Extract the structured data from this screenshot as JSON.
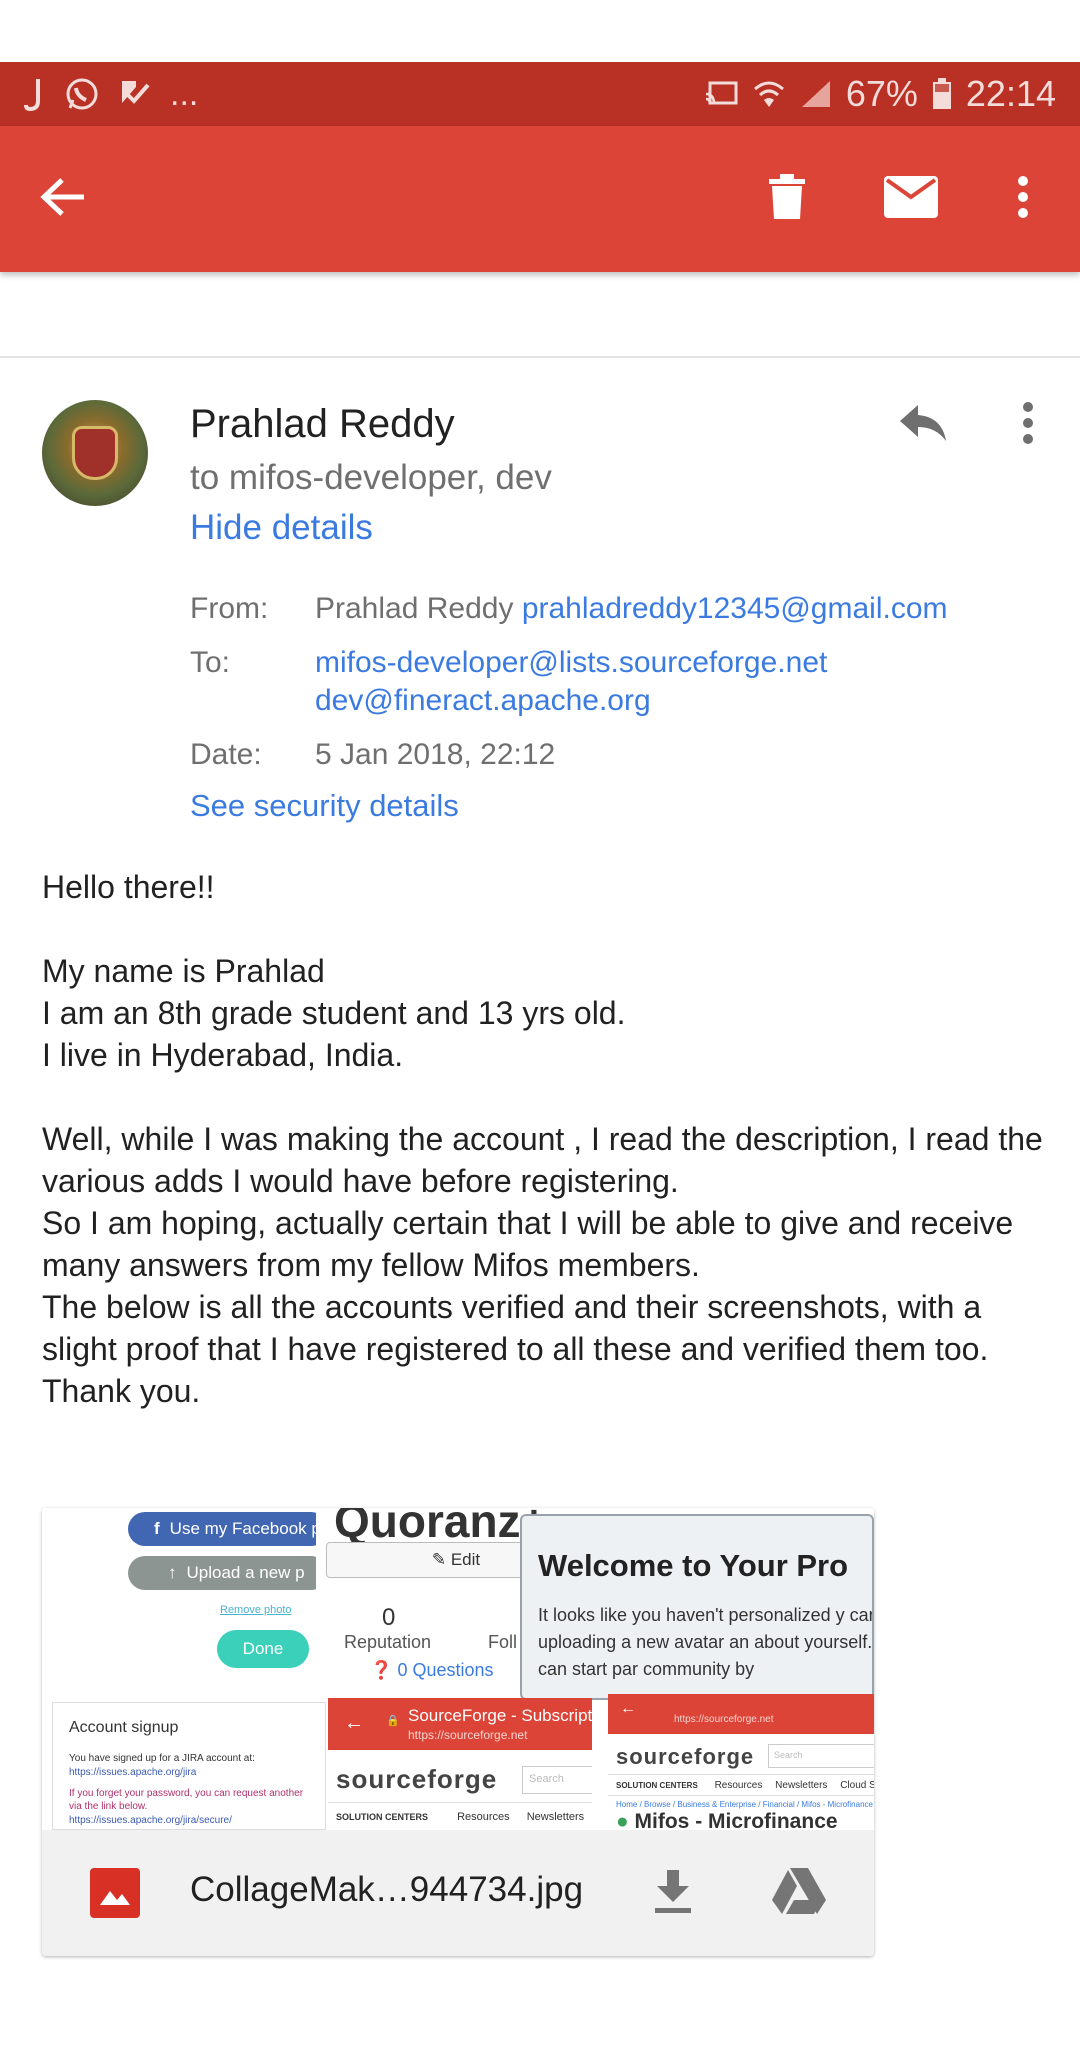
{
  "status_bar": {
    "time": "22:14",
    "battery": "67%",
    "overflow": "...",
    "colors": {
      "bg": "#b93025"
    }
  },
  "app_bar": {
    "back_icon": "arrow-back-icon",
    "actions": [
      "delete-icon",
      "mail-icon",
      "more-vert-icon"
    ],
    "colors": {
      "bg": "#db4437"
    }
  },
  "message": {
    "sender": "Prahlad Reddy",
    "recipients": "to mifos-developer, dev",
    "hide_details": "Hide details",
    "details": {
      "from_label": "From:",
      "from_name": "Prahlad Reddy",
      "from_email": "prahladreddy12345@gmail.com",
      "to_label": "To:",
      "to_1": "mifos-developer@lists.sourceforge.net",
      "to_2": "dev@fineract.apache.org",
      "date_label": "Date:",
      "date": "5 Jan 2018, 22:12"
    },
    "security_link": "See security details",
    "body": {
      "greeting": "Hello there!!",
      "para1": "My name is Prahlad\nI am an 8th grade student and 13 yrs old.\nI live in Hyderabad, India.",
      "para2": "Well, while I was making the account , I read the description, I read the various adds I would have before registering.\nSo I am hoping, actually certain that I will be able to give and receive many answers from my fellow Mifos members.\nThe below is all the accounts verified and their screenshots, with a slight proof that I have registered to all these and verified them too.\nThank you."
    }
  },
  "attachment": {
    "file_name": "CollageMak…944734.jpg",
    "preview": {
      "fb_button": "Use my Facebook p",
      "upload_button": "Upload a new p",
      "remove_photo": "Remove photo",
      "done_button": "Done",
      "qa_title": "Quoranz+",
      "edit_button": "Edit",
      "reputation_value": "0",
      "reputation_label": "Reputation",
      "following_label": "Foll",
      "questions": "0 Questions",
      "welcome_title": "Welcome to Your Pro",
      "welcome_text": "It looks like you haven't personalized y can start by uploading a new avatar an about yourself. Then you can start par community by",
      "jira_title": "Account signup",
      "jira_line1": "You have signed up for a JIRA account at:",
      "jira_link1": "https://issues.apache.org/jira",
      "jira_line2": "If you forget your password, you can request another via the link below.",
      "jira_link2": "https://issues.apache.org/jira/secure/",
      "sf_tab_title": "SourceForge - Subscript",
      "sf_url": "https://sourceforge.net",
      "sf_logo": "sourceforge",
      "sf_search": "Search",
      "sf_nav": [
        "SOLUTION CENTERS",
        "Resources",
        "Newsletters",
        "Cloud St"
      ],
      "sf_breadcrumb": "Home / Browse / Business & Enterprise / Financial / Mifos - Microfinance",
      "sf_project": "Mifos - Microfinance"
    }
  }
}
